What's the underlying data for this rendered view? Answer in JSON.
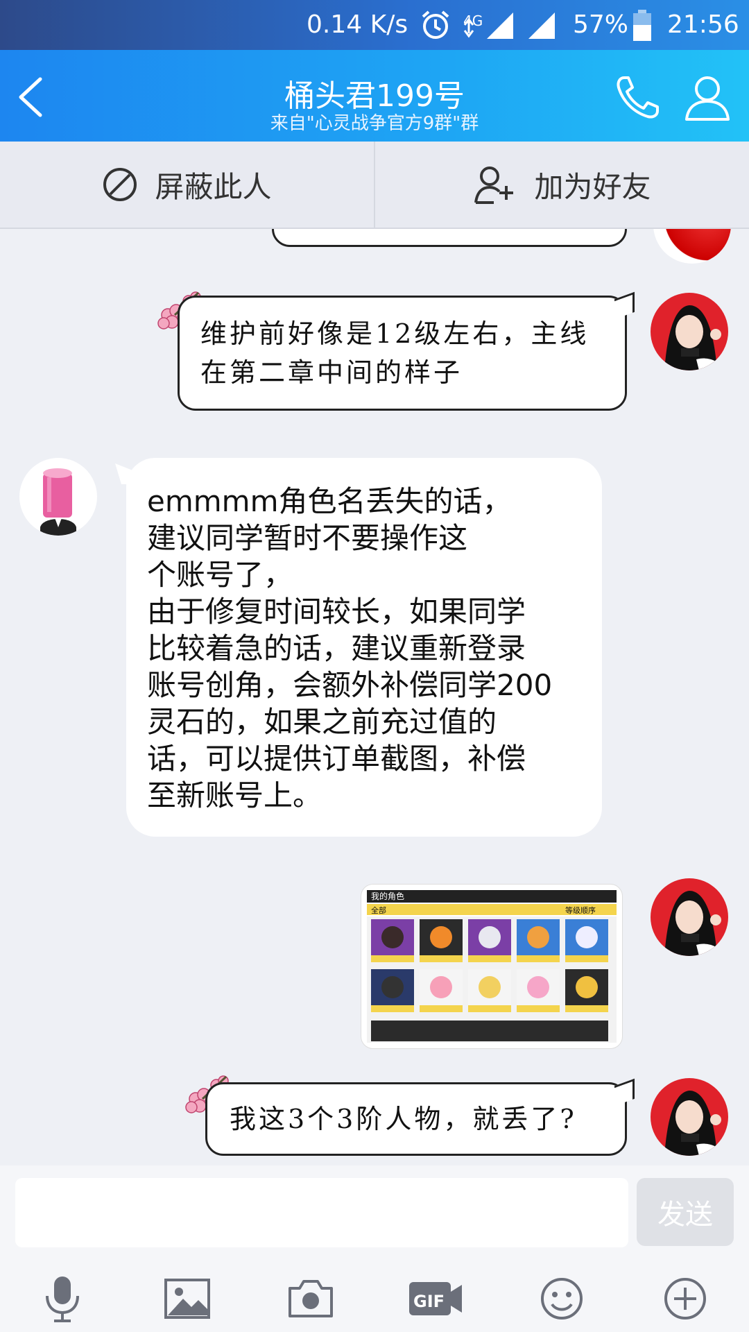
{
  "status_bar": {
    "network_speed": "0.14 K/s",
    "network_type": "4G",
    "battery": "57%",
    "time": "21:56"
  },
  "header": {
    "title": "桶头君199号",
    "subtitle": "来自\"心灵战争官方9群\"群"
  },
  "actions": {
    "block_label": "屏蔽此人",
    "add_friend_label": "加为好友"
  },
  "messages": [
    {
      "side": "right",
      "type": "text",
      "lines": [
        "维护前好像是12级左右，主线",
        "在第二章中间的样子"
      ]
    },
    {
      "side": "left",
      "type": "text",
      "lines": [
        "emmmm角色名丢失的话，",
        "建议同学暂时不要操作这",
        "个账号了，",
        "由于修复时间较长，如果同学",
        "比较着急的话，建议重新登录",
        "账号创角，会额外补偿同学200",
        "灵石的，如果之前充过值的",
        "话，可以提供订单截图，补偿",
        "至新账号上。"
      ]
    },
    {
      "side": "right",
      "type": "image",
      "caption": {
        "title": "我的角色",
        "tab_all": "全部",
        "sort": "等级顺序"
      }
    },
    {
      "side": "right",
      "type": "text",
      "lines": [
        "我这3个3阶人物，就丢了?"
      ]
    }
  ],
  "input": {
    "value": "",
    "placeholder": "",
    "send_label": "发送"
  },
  "toolbar_icons": [
    "microphone-icon",
    "image-icon",
    "camera-icon",
    "gif-icon",
    "emoji-icon",
    "plus-icon"
  ],
  "colors": {
    "header_blue": "#1ea6f4",
    "status_blue": "#2a6fd0",
    "bubble_border": "#222222",
    "chat_bg": "#eef0f5"
  }
}
